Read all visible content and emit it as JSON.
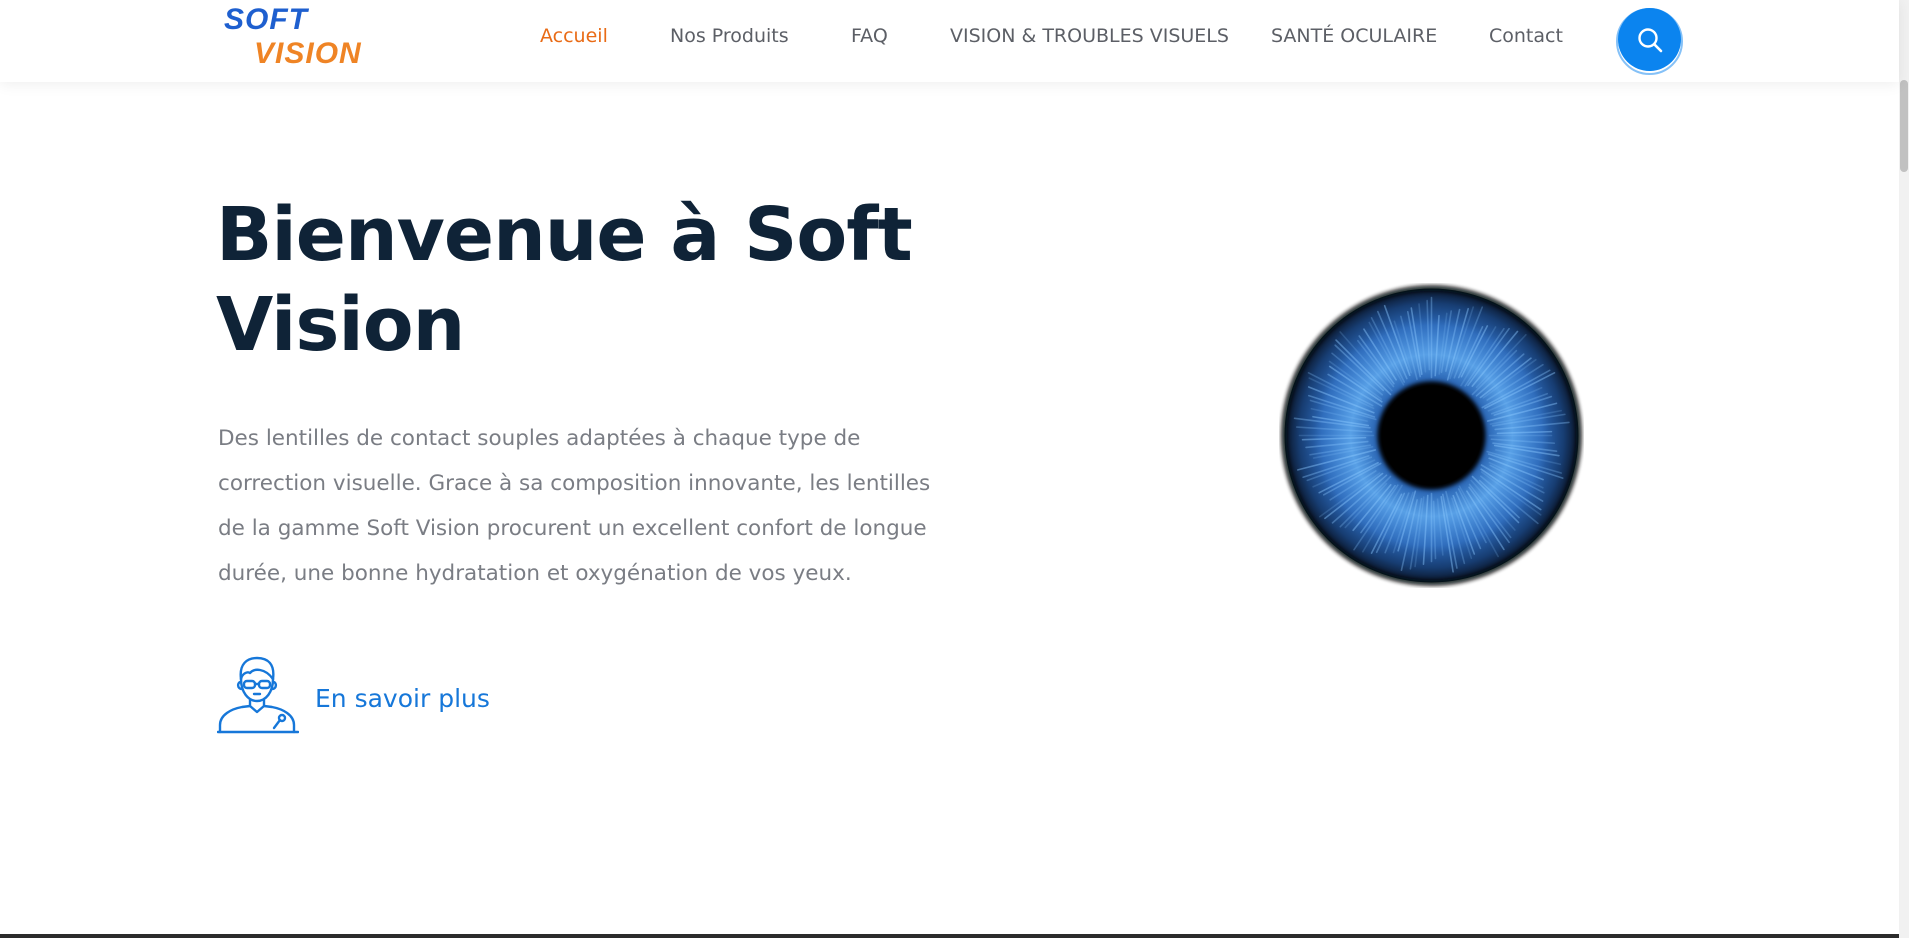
{
  "brand": {
    "logo_line1": "SOFT",
    "logo_line2": "VISION",
    "primary_color": "#1e5fcf",
    "secondary_color": "#ef8425"
  },
  "nav": {
    "items": [
      {
        "label": "Accueil",
        "active": true
      },
      {
        "label": "Nos Produits",
        "active": false
      },
      {
        "label": "FAQ",
        "active": false
      },
      {
        "label": "VISION & TROUBLES VISUELS",
        "active": false
      },
      {
        "label": "SANTÉ OCULAIRE",
        "active": false
      },
      {
        "label": "Contact",
        "active": false
      }
    ],
    "active_color": "#e96b16",
    "search_icon": "search-icon",
    "search_button_color": "#0b84ef"
  },
  "hero": {
    "title": "Bienvenue à Soft Vision",
    "description": "Des lentilles de contact souples adaptées à chaque type de correction visuelle. Grace à sa composition innovante, les lentilles de la gamme Soft Vision procurent un excellent confort de longue durée, une bonne hydratation et oxygénation de vos yeux.",
    "cta_label": "En savoir plus",
    "cta_icon": "optician-person-icon",
    "cta_color": "#1677d9"
  },
  "image": {
    "subject": "eye-iris-icon"
  }
}
